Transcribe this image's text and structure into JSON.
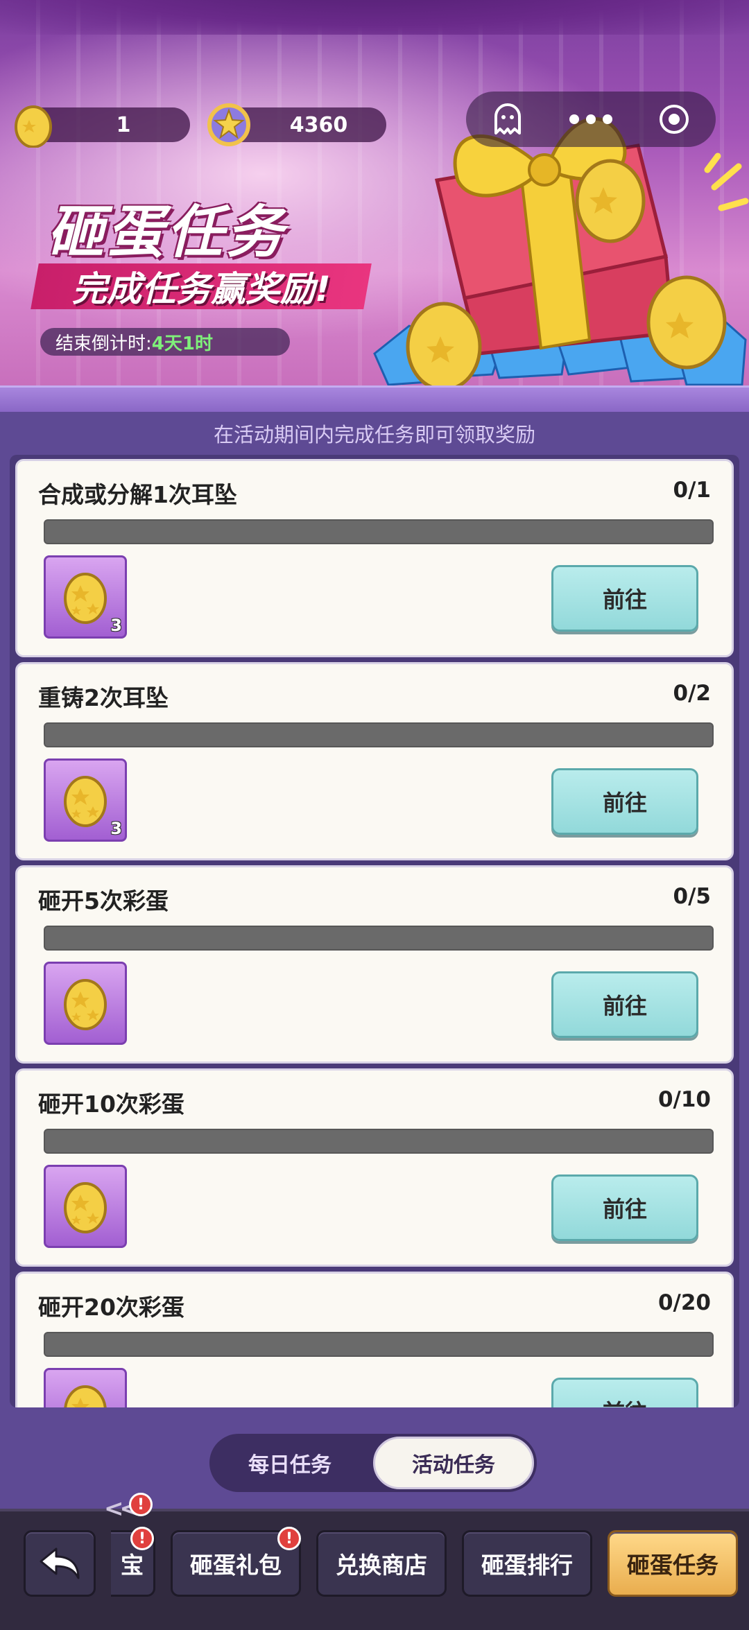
{
  "currency": {
    "eggs": "1",
    "stars": "4360"
  },
  "banner": {
    "title": "砸蛋任务",
    "subtitle": "完成任务赢奖励!",
    "countdown_label": "结束倒计时:",
    "countdown_value": "4天1时"
  },
  "hint": "在活动期间内完成任务即可领取奖励",
  "tasks": [
    {
      "title": "合成或分解1次耳坠",
      "count": "0/1",
      "progress": 0,
      "reward_qty": "3",
      "button": "前往"
    },
    {
      "title": "重铸2次耳坠",
      "count": "0/2",
      "progress": 0,
      "reward_qty": "3",
      "button": "前往"
    },
    {
      "title": "砸开5次彩蛋",
      "count": "0/5",
      "progress": 0,
      "reward_qty": "",
      "button": "前往"
    },
    {
      "title": "砸开10次彩蛋",
      "count": "0/10",
      "progress": 0,
      "reward_qty": "",
      "button": "前往"
    },
    {
      "title": "砸开20次彩蛋",
      "count": "0/20",
      "progress": 0,
      "reward_qty": "",
      "button": "前往"
    }
  ],
  "tabs": {
    "daily": "每日任务",
    "event": "活动任务",
    "active": "event"
  },
  "nav": {
    "back_icon": "back-arrow-icon",
    "items": [
      {
        "label": "宝",
        "badge": "!"
      },
      {
        "label": "砸蛋礼包",
        "badge": "!"
      },
      {
        "label": "兑换商店",
        "badge": ""
      },
      {
        "label": "砸蛋排行",
        "badge": ""
      },
      {
        "label": "砸蛋任务",
        "badge": "",
        "active": true
      }
    ],
    "scroll_badge": "!"
  },
  "colors": {
    "accent_gold": "#e9ad4e",
    "go_button": "#92d9da",
    "panel": "#4a3a78",
    "badge": "#e0403e"
  }
}
